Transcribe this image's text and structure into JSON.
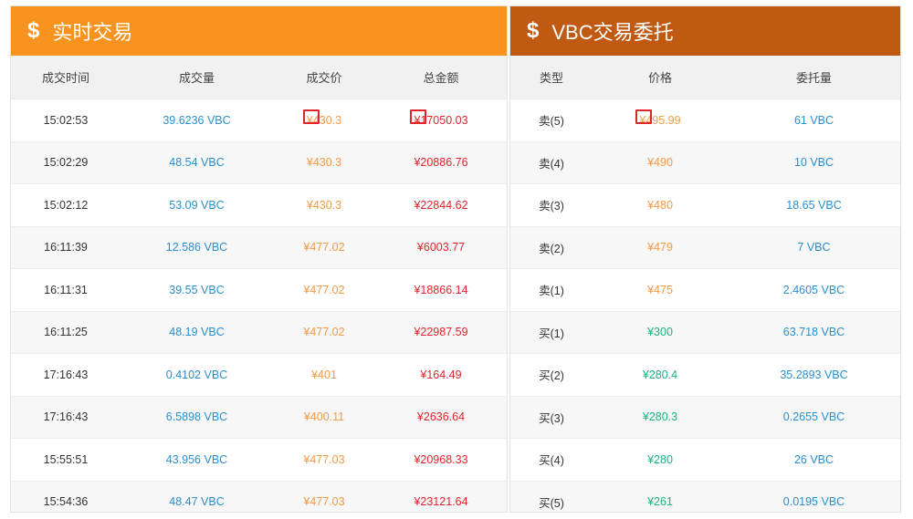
{
  "trades_panel": {
    "icon": "dollar-icon",
    "title": "实时交易",
    "headers": [
      "成交时间",
      "成交量",
      "成交价",
      "总金额"
    ],
    "rows": [
      {
        "time": "15:02:53",
        "volume": "39.6236 VBC",
        "price": "¥430.3",
        "total": "¥17050.03"
      },
      {
        "time": "15:02:29",
        "volume": "48.54 VBC",
        "price": "¥430.3",
        "total": "¥20886.76"
      },
      {
        "time": "15:02:12",
        "volume": "53.09 VBC",
        "price": "¥430.3",
        "total": "¥22844.62"
      },
      {
        "time": "16:11:39",
        "volume": "12.586 VBC",
        "price": "¥477.02",
        "total": "¥6003.77"
      },
      {
        "time": "16:11:31",
        "volume": "39.55 VBC",
        "price": "¥477.02",
        "total": "¥18866.14"
      },
      {
        "time": "16:11:25",
        "volume": "48.19 VBC",
        "price": "¥477.02",
        "total": "¥22987.59"
      },
      {
        "time": "17:16:43",
        "volume": "0.4102 VBC",
        "price": "¥401",
        "total": "¥164.49"
      },
      {
        "time": "17:16:43",
        "volume": "6.5898 VBC",
        "price": "¥400.11",
        "total": "¥2636.64"
      },
      {
        "time": "15:55:51",
        "volume": "43.956 VBC",
        "price": "¥477.03",
        "total": "¥20968.33"
      },
      {
        "time": "15:54:36",
        "volume": "48.47 VBC",
        "price": "¥477.03",
        "total": "¥23121.64"
      }
    ]
  },
  "orders_panel": {
    "icon": "dollar-icon",
    "title": "VBC交易委托",
    "headers": [
      "类型",
      "价格",
      "委托量"
    ],
    "rows": [
      {
        "type": "卖(5)",
        "price": "¥495.99",
        "amount": "61 VBC",
        "side": "sell"
      },
      {
        "type": "卖(4)",
        "price": "¥490",
        "amount": "10 VBC",
        "side": "sell"
      },
      {
        "type": "卖(3)",
        "price": "¥480",
        "amount": "18.65 VBC",
        "side": "sell"
      },
      {
        "type": "卖(2)",
        "price": "¥479",
        "amount": "7 VBC",
        "side": "sell"
      },
      {
        "type": "卖(1)",
        "price": "¥475",
        "amount": "2.4605 VBC",
        "side": "sell"
      },
      {
        "type": "买(1)",
        "price": "¥300",
        "amount": "63.718 VBC",
        "side": "buy"
      },
      {
        "type": "买(2)",
        "price": "¥280.4",
        "amount": "35.2893 VBC",
        "side": "buy"
      },
      {
        "type": "买(3)",
        "price": "¥280.3",
        "amount": "0.2655 VBC",
        "side": "buy"
      },
      {
        "type": "买(4)",
        "price": "¥280",
        "amount": "26 VBC",
        "side": "buy"
      },
      {
        "type": "买(5)",
        "price": "¥261",
        "amount": "0.0195 VBC",
        "side": "buy"
      }
    ]
  },
  "colors": {
    "trades_header": "#f7931e",
    "orders_header": "#c05a12",
    "volume_blue": "#2a8fd0",
    "price_orange": "#f39a47",
    "total_red": "#e3242b",
    "buy_green": "#19b57e",
    "highlight_box": "#e3242b"
  },
  "highlight_note_cells": [
    "trades.row0.price",
    "trades.row0.total",
    "orders.row0.price"
  ]
}
